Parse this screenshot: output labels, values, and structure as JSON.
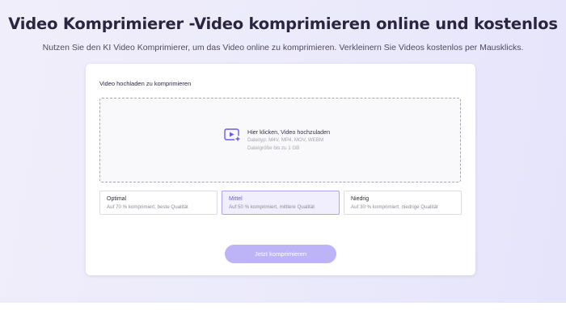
{
  "header": {
    "title": "Video Komprimierer -Video komprimieren online und kostenlos",
    "subtitle": "Nutzen Sie den KI Video Komprimierer, um das Video online zu komprimieren. Verkleinern Sie Videos kostenlos per Mausklicks."
  },
  "uploader": {
    "label": "Video hochladen zu komprimieren",
    "prompt": "Hier klicken, Video hochzuladen",
    "filetypes": "Dateityp: M4V, MP4, MOV, WEBM",
    "filesize": "Dateigröße bis zu 1 GB",
    "icon": "video-upload-icon"
  },
  "options": [
    {
      "name": "Optimal",
      "desc": "Auf 70 % komprimiert, beste Qualität",
      "selected": false
    },
    {
      "name": "Mittel",
      "desc": "Auf 50 % komprimiert, mittlere Qualität",
      "selected": true
    },
    {
      "name": "Niedrig",
      "desc": "Auf 30 % komprimiert, niedrige Qualität",
      "selected": false
    }
  ],
  "action": {
    "compress_label": "Jetzt komprimieren"
  },
  "colors": {
    "accent": "#7159e3",
    "button": "#bdb4f8",
    "selected_bg": "#f1eefd",
    "hero_bg": "#ecebfb"
  }
}
